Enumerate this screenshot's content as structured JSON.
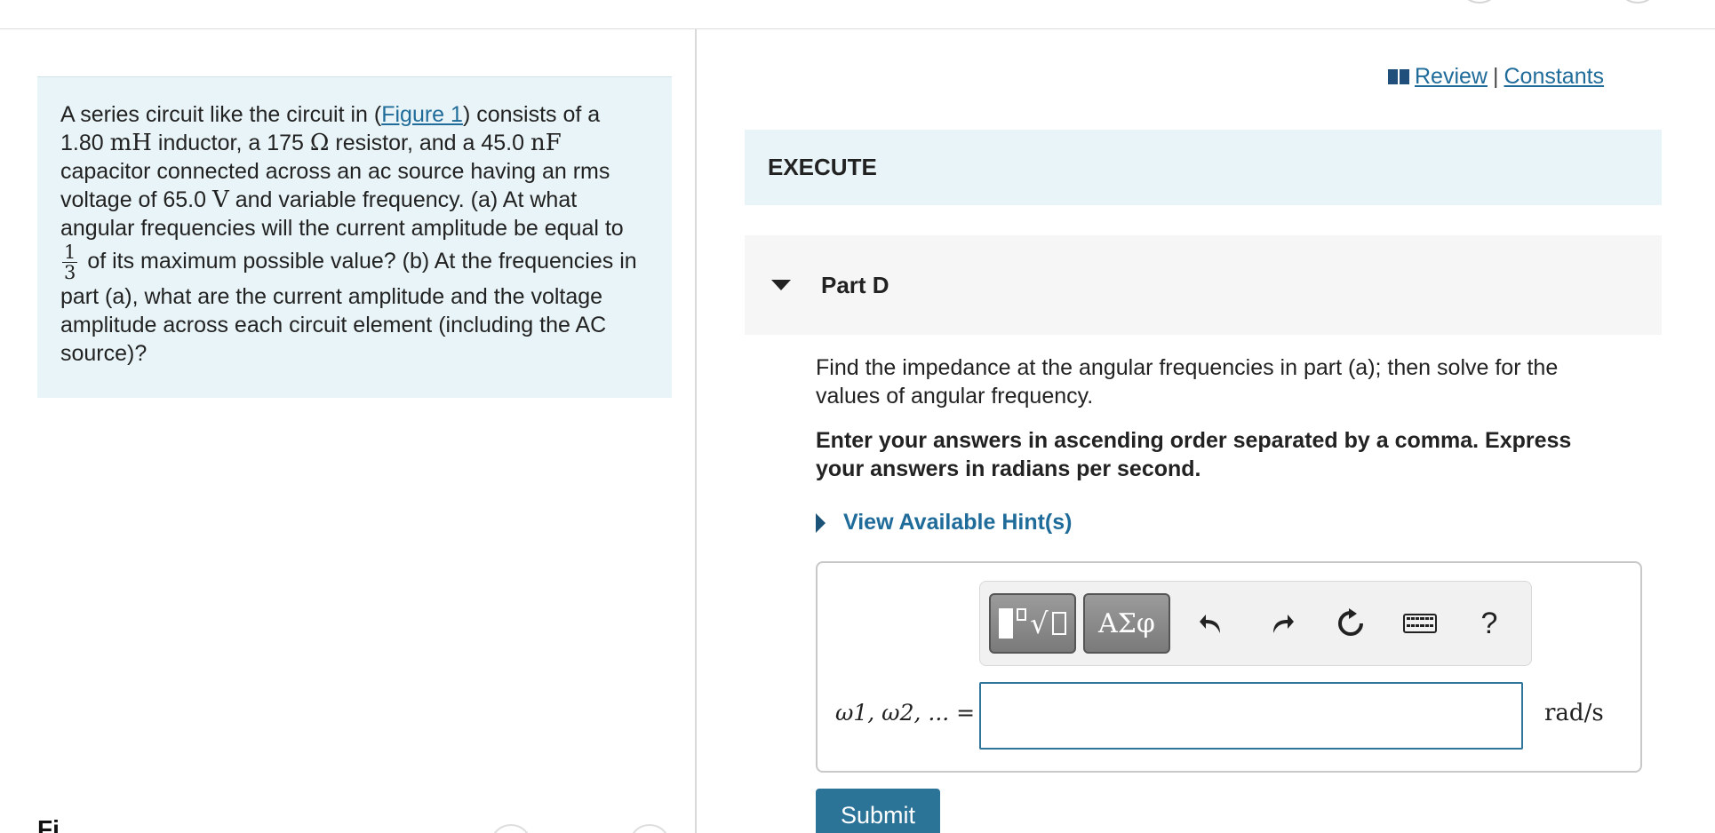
{
  "problem": {
    "t1": "A series circuit like the circuit in (",
    "figure_link": "Figure 1",
    "t2": ") consists of a 1.80",
    "u1": "mH",
    "t3": " inductor, a 175",
    "u2": "Ω",
    "t4": " resistor, and a 45.0",
    "u3": "nF",
    "t5": " capacitor connected across an ac source having an rms voltage of 65.0",
    "u4": "V",
    "t6": " and variable frequency. (a) At what angular frequencies will the current amplitude be equal to",
    "frac_num": "1",
    "frac_den": "3",
    "t7": " of its maximum possible value? (b) At the frequencies in part (a), what are the current amplitude and the voltage amplitude across each circuit element (including the AC source)?"
  },
  "figure_heading_stub": "Fi",
  "links": {
    "review": "Review",
    "separator": "|",
    "constants": "Constants"
  },
  "execute_label": "EXECUTE",
  "part": {
    "label": "Part D"
  },
  "instructions": "Find the impedance at the angular frequencies in part (a); then solve for the values of angular frequency.",
  "instructions_bold": "Enter your answers in ascending order separated by a comma. Express your answers in radians per second.",
  "hint_label": "View Available Hint(s)",
  "toolbar": {
    "greek_label": "ΑΣφ",
    "help_label": "?",
    "icons": [
      "templates-icon",
      "greek-symbols-icon",
      "undo-icon",
      "redo-icon",
      "reset-icon",
      "keyboard-icon",
      "help-icon"
    ]
  },
  "answer": {
    "label": "ω1, ω2, ... =",
    "value": "",
    "unit": "rad/s"
  },
  "submit_label": "Submit",
  "colors": {
    "accent": "#2c7398",
    "link": "#1f6b9a",
    "panel_bg": "#e8f4f7"
  }
}
